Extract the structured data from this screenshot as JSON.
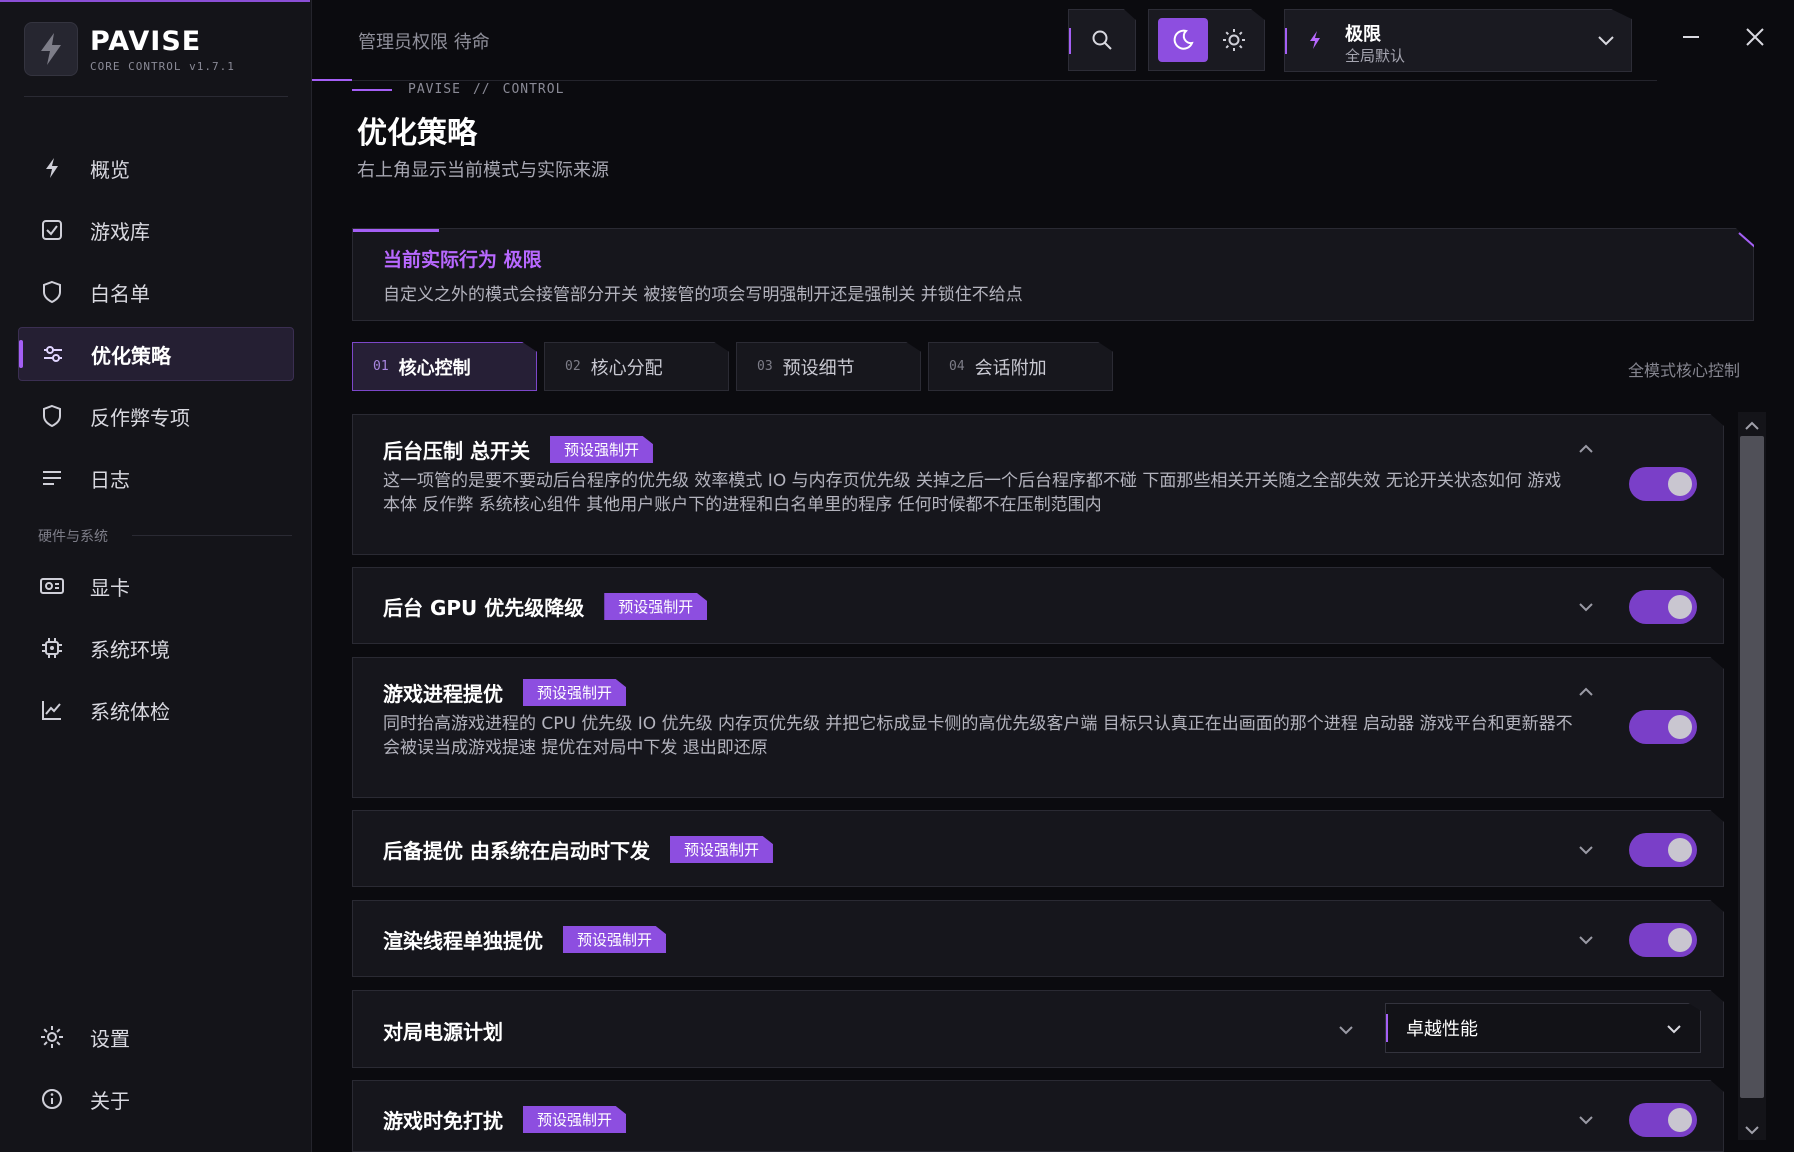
{
  "app": {
    "name": "PAVISE",
    "version": "CORE CONTROL v1.7.1"
  },
  "sidebar": {
    "items": [
      {
        "label": "概览",
        "icon": "bolt-icon"
      },
      {
        "label": "游戏库",
        "icon": "checkbox-icon"
      },
      {
        "label": "白名单",
        "icon": "shield-icon"
      },
      {
        "label": "优化策略",
        "icon": "sliders-icon",
        "active": true
      },
      {
        "label": "反作弊专项",
        "icon": "shield-icon"
      },
      {
        "label": "日志",
        "icon": "list-icon"
      }
    ],
    "section_label": "硬件与系统",
    "hw_items": [
      {
        "label": "显卡",
        "icon": "gpu-icon"
      },
      {
        "label": "系统环境",
        "icon": "chip-icon"
      },
      {
        "label": "系统体检",
        "icon": "chart-icon"
      }
    ],
    "bottom_items": [
      {
        "label": "设置",
        "icon": "gear-icon"
      },
      {
        "label": "关于",
        "icon": "info-icon"
      }
    ]
  },
  "topbar": {
    "admin_status": "管理员权限 待命",
    "mode_title": "极限",
    "mode_sub": "全局默认"
  },
  "header": {
    "breadcrumb": [
      "PAVISE",
      "//",
      "CONTROL"
    ],
    "title": "优化策略",
    "subtitle": "右上角显示当前模式与实际来源"
  },
  "banner": {
    "title": "当前实际行为 极限",
    "text": "自定义之外的模式会接管部分开关 被接管的项会写明强制开还是强制关 并锁住不给点"
  },
  "tabs": [
    {
      "num": "01",
      "label": "核心控制",
      "active": true
    },
    {
      "num": "02",
      "label": "核心分配"
    },
    {
      "num": "03",
      "label": "预设细节"
    },
    {
      "num": "04",
      "label": "会话附加"
    }
  ],
  "tabs_caption": "全模式核心控制",
  "cards": [
    {
      "title": "后台压制 总开关",
      "badge": "预设强制开",
      "expanded": true,
      "on": true,
      "desc": "这一项管的是要不要动后台程序的优先级 效率模式 IO 与内存页优先级 关掉之后一个后台程序都不碰 下面那些相关开关随之全部失效 无论开关状态如何 游戏本体 反作弊 系统核心组件 其他用户账户下的进程和白名单里的程序 任何时候都不在压制范围内"
    },
    {
      "title": "后台 GPU 优先级降级",
      "badge": "预设强制开",
      "expanded": false,
      "on": true
    },
    {
      "title": "游戏进程提优",
      "badge": "预设强制开",
      "expanded": true,
      "on": true,
      "desc": "同时抬高游戏进程的 CPU 优先级 IO 优先级 内存页优先级 并把它标成显卡侧的高优先级客户端 目标只认真正在出画面的那个进程 启动器 游戏平台和更新器不会被误当成游戏提速 提优在对局中下发 退出即还原"
    },
    {
      "title": "后备提优 由系统在启动时下发",
      "badge": "预设强制开",
      "expanded": false,
      "on": true
    },
    {
      "title": "渲染线程单独提优",
      "badge": "预设强制开",
      "expanded": false,
      "on": true
    },
    {
      "title": "对局电源计划",
      "select_value": "卓越性能"
    },
    {
      "title": "游戏时免打扰",
      "badge": "预设强制开",
      "expanded": false,
      "on": true
    }
  ],
  "colors": {
    "accent": "#a45ff5",
    "badge": "#8d4ee0",
    "toggle_on": "#7a3fc8",
    "background": "#0b0b0f",
    "panel": "#16161c"
  }
}
